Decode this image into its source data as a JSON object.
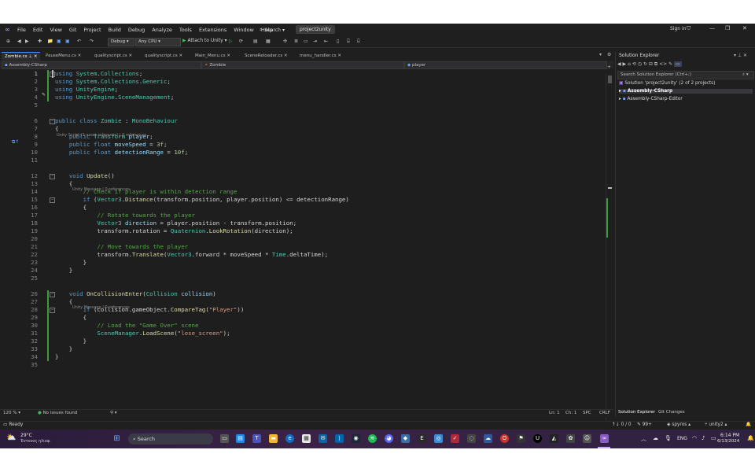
{
  "menu": [
    "File",
    "Edit",
    "View",
    "Git",
    "Project",
    "Build",
    "Debug",
    "Analyze",
    "Tools",
    "Extensions",
    "Window",
    "Help"
  ],
  "search_label": "Search",
  "project_name": "project2unity",
  "sign_in": "Sign in",
  "toolbar": {
    "config": "Debug",
    "platform": "Any CPU",
    "attach": "Attach to Unity"
  },
  "tabs": [
    {
      "label": "Zombie.cs",
      "active": true
    },
    {
      "label": "PauseMenu.cs"
    },
    {
      "label": "qualityscript.cs"
    },
    {
      "label": "qualityscript.cs"
    },
    {
      "label": "Main_Menu.cs"
    },
    {
      "label": "SceneReloader.cs"
    },
    {
      "label": "menu_handler.cs"
    }
  ],
  "nav": {
    "project": "Assembly-CSharp",
    "class": "Zombie",
    "member": "player"
  },
  "lens": {
    "class": "Unity Script (1 asset reference) | 0 references",
    "update": "Unity Message | 0 references",
    "collision": "Unity Message | 0 references"
  },
  "code_lines": [
    {
      "n": "1",
      "html": "<span class='kw'>using</span> <span class='ty'>System</span>.<span class='ty'>Collections</span>;"
    },
    {
      "n": "2",
      "html": "<span class='kw'>using</span> <span class='ty'>System</span>.<span class='ty'>Collections</span>.<span class='ty'>Generic</span>;"
    },
    {
      "n": "3",
      "html": "<span class='kw'>using</span> <span class='ty'>UnityEngine</span>;"
    },
    {
      "n": "4",
      "html": "<span class='kw'>using</span> <span class='ty'>UnityEngine</span>.<span class='ty'>SceneManagement</span>;"
    },
    {
      "n": "5",
      "html": ""
    },
    {
      "n": "6",
      "html": "<span class='kw'>public class</span> <span class='ty'>Zombie</span> : <span class='ty'>MonoBehaviour</span>"
    },
    {
      "n": "7",
      "html": "{"
    },
    {
      "n": "8",
      "html": "    <span class='kw'>public</span> <span class='ty'>Transform</span> <span class='vr'>player</span>;"
    },
    {
      "n": "9",
      "html": "    <span class='kw'>public float</span> <span class='vr'>moveSpeed</span> = <span class='nm'>3f</span>;"
    },
    {
      "n": "10",
      "html": "    <span class='kw'>public float</span> <span class='vr'>detectionRange</span> = <span class='nm'>10f</span>;"
    },
    {
      "n": "11",
      "html": ""
    },
    {
      "n": "12",
      "html": "    <span class='kw'>void</span> <span class='fn'>Update</span>()"
    },
    {
      "n": "13",
      "html": "    {"
    },
    {
      "n": "14",
      "html": "        <span class='cm'>// Check if player is within detection range</span>"
    },
    {
      "n": "15",
      "html": "        <span class='kw'>if</span> (<span class='ty'>Vector3</span>.<span class='fn'>Distance</span>(transform.position, player.position) &lt;= detectionRange)"
    },
    {
      "n": "16",
      "html": "        {"
    },
    {
      "n": "17",
      "html": "            <span class='cm'>// Rotate towards the player</span>"
    },
    {
      "n": "18",
      "html": "            <span class='ty'>Vector3</span> <span class='vr'>direction</span> = player.position - transform.position;"
    },
    {
      "n": "19",
      "html": "            transform.rotation = <span class='ty'>Quaternion</span>.<span class='fn'>LookRotation</span>(direction);"
    },
    {
      "n": "20",
      "html": ""
    },
    {
      "n": "21",
      "html": "            <span class='cm'>// Move towards the player</span>"
    },
    {
      "n": "22",
      "html": "            transform.<span class='fn'>Translate</span>(<span class='ty'>Vector3</span>.forward * moveSpeed * <span class='ty'>Time</span>.deltaTime);"
    },
    {
      "n": "23",
      "html": "        }"
    },
    {
      "n": "24",
      "html": "    }"
    },
    {
      "n": "25",
      "html": ""
    },
    {
      "n": "26",
      "html": "    <span class='kw'>void</span> <span class='fn'>OnCollisionEnter</span>(<span class='ty'>Collision</span> <span class='vr'>collision</span>)"
    },
    {
      "n": "27",
      "html": "    {"
    },
    {
      "n": "28",
      "html": "        <span class='kw'>if</span> (collision.gameObject.<span class='fn'>CompareTag</span>(<span class='st'>\"Player\"</span>))"
    },
    {
      "n": "29",
      "html": "        {"
    },
    {
      "n": "30",
      "html": "            <span class='cm'>// Load the \"Game Over\" scene</span>"
    },
    {
      "n": "31",
      "html": "            <span class='ty'>SceneManager</span>.<span class='fn'>LoadScene</span>(<span class='st'>\"lose_screen\"</span>);"
    },
    {
      "n": "32",
      "html": "        }"
    },
    {
      "n": "33",
      "html": "    }"
    },
    {
      "n": "34",
      "html": "}"
    },
    {
      "n": "35",
      "html": ""
    }
  ],
  "editor_status": {
    "zoom": "120 %",
    "issues": "No issues found",
    "line": "Ln: 1",
    "col": "Ch: 1",
    "spc": "SPC",
    "crlf": "CRLF"
  },
  "solution_explorer": {
    "title": "Solution Explorer",
    "search_placeholder": "Search Solution Explorer (Ctrl+;)",
    "solution": "Solution 'project2unity' (2 of 2 projects)",
    "projects": [
      "Assembly-CSharp",
      "Assembly-CSharp-Editor"
    ],
    "tabs": [
      "Solution Explorer",
      "Git Changes"
    ]
  },
  "status": {
    "ready": "Ready",
    "errors": "0 / 0",
    "changes": "99+",
    "user": "spyros",
    "branch": "unity2"
  },
  "taskbar": {
    "temp": "29°C",
    "weather": "Έντονος ηλιοφ.",
    "search": "Search",
    "lang": "ENG",
    "time": "6:14 PM",
    "date": "6/13/2024"
  },
  "colors": {
    "accent": "#3794ff",
    "vs_purple": "#8a5cc7",
    "change_bar": "#3c9b3c"
  }
}
